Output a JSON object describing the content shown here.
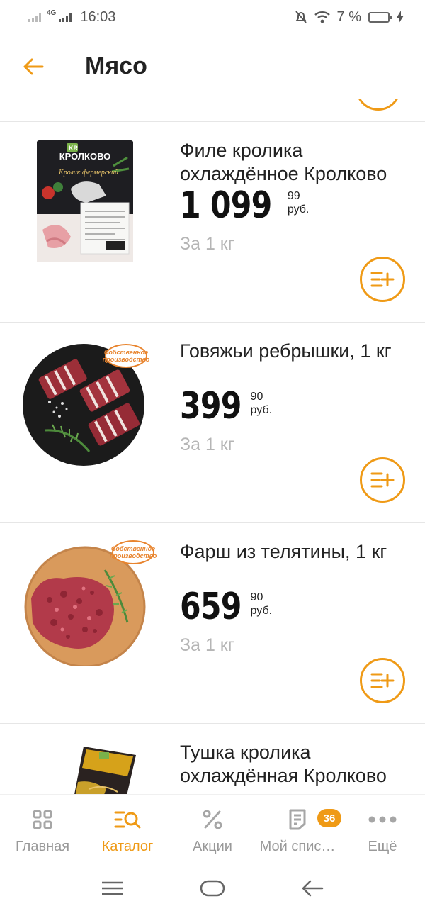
{
  "status_bar": {
    "network": "4G",
    "time": "16:03",
    "battery": "7 %"
  },
  "header": {
    "title": "Мясо"
  },
  "products": [
    {
      "name": "Филе кролика охлаждённое Кролково",
      "price_int": "1 099",
      "price_kop": "99",
      "currency": "руб.",
      "unit": "За 1 кг",
      "package_brand": "КРОЛКОВО",
      "package_subtitle": "Кролик фермерский"
    },
    {
      "name": "Говяжьи ребрышки, 1 кг",
      "price_int": "399",
      "price_kop": "90",
      "currency": "руб.",
      "unit": "За 1 кг",
      "badge": "Собственное производство"
    },
    {
      "name": "Фарш из телятины, 1 кг",
      "price_int": "659",
      "price_kop": "90",
      "currency": "руб.",
      "unit": "За 1 кг",
      "badge": "Собственное производство"
    },
    {
      "name": "Тушка кролика охлаждённая Кролково"
    }
  ],
  "bottom_nav": [
    {
      "label": "Главная",
      "icon": "grid-icon"
    },
    {
      "label": "Каталог",
      "icon": "catalog-search-icon"
    },
    {
      "label": "Акции",
      "icon": "percent-icon"
    },
    {
      "label": "Мой спис…",
      "icon": "list-icon",
      "badge": "36"
    },
    {
      "label": "Ещё",
      "icon": "more-dots-icon"
    }
  ],
  "colors": {
    "accent": "#ef9a16",
    "muted_text": "#b5b5b5",
    "inactive_nav": "#999999"
  }
}
